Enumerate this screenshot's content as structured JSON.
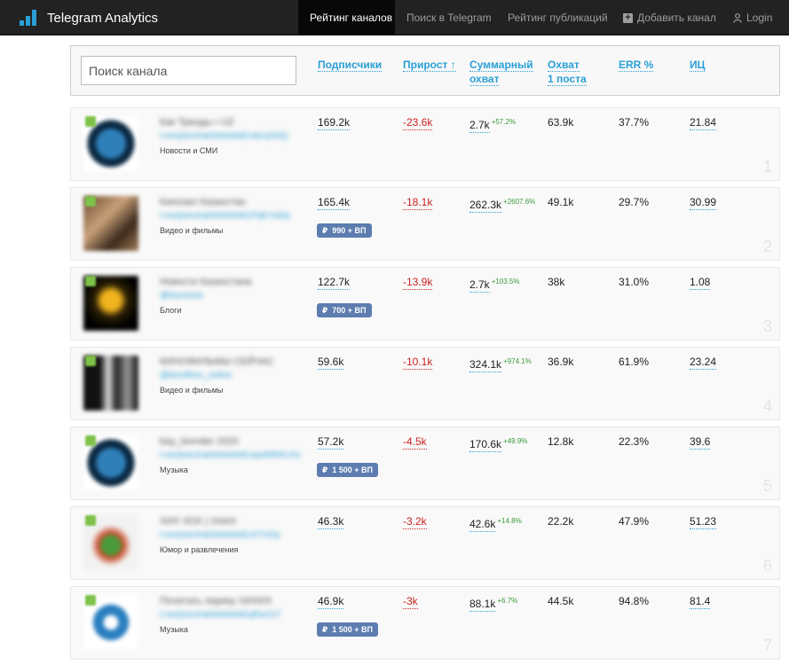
{
  "brand": {
    "title": "Telegram Analytics"
  },
  "nav": {
    "items": [
      {
        "label": "Рейтинг каналов",
        "active": true
      },
      {
        "label": "Поиск в Telegram",
        "active": false
      },
      {
        "label": "Рейтинг публикаций",
        "active": false
      },
      {
        "label": "Добавить канал",
        "active": false,
        "icon": "plus-square-icon"
      },
      {
        "label": "Login",
        "active": false,
        "icon": "user-icon"
      }
    ]
  },
  "search": {
    "placeholder": "Поиск канала",
    "value": ""
  },
  "columns": {
    "subscribers": "Подписчики",
    "growth": "Прирост ↑",
    "total_reach_1": "Суммарный",
    "total_reach_2": "охват",
    "post_reach_1": "Охват",
    "post_reach_2": "1 поста",
    "err": "ERR %",
    "ic": "ИЦ"
  },
  "rows": [
    {
      "rank": "1",
      "name": "Как Тренды • UZ",
      "link": "t.me/joinchat/AAAAAEvdsUjXdQ",
      "category": "Новости и СМИ",
      "subscribers": "169.2k",
      "growth": "-23.6k",
      "reach": "2.7k",
      "reach_delta": "+57.2%",
      "post_reach": "63.9k",
      "err": "37.7%",
      "ic": "21.84",
      "price": ""
    },
    {
      "rank": "2",
      "name": "Кинозал Казахстан",
      "link": "t.me/joinchat/AAAAAErPqkYwDq",
      "category": "Видео и фильмы",
      "subscribers": "165.4k",
      "growth": "-18.1k",
      "reach": "262.3k",
      "reach_delta": "+2607.6%",
      "post_reach": "49.1k",
      "err": "29.7%",
      "ic": "30.99",
      "price": "990 + ВП"
    },
    {
      "rank": "3",
      "name": "Новости Казахстана",
      "link": "@kaznews",
      "category": "Блоги",
      "subscribers": "122.7k",
      "growth": "-13.9k",
      "reach": "2.7k",
      "reach_delta": "+103.5%",
      "post_reach": "38k",
      "err": "31.0%",
      "ic": "1.08",
      "price": "700 + ВП"
    },
    {
      "rank": "4",
      "name": "КИНОФИЛЬМЫ СЕЙЧАС",
      "link": "@kinofilms_online",
      "category": "Видео и фильмы",
      "subscribers": "59.6k",
      "growth": "-10.1k",
      "reach": "324.1k",
      "reach_delta": "+974.1%",
      "post_reach": "36.9k",
      "err": "61.9%",
      "ic": "23.24",
      "price": ""
    },
    {
      "rank": "5",
      "name": "bay_bomder 2020",
      "link": "t.me/joinchat/AAAAAExqsdWhKvXz",
      "category": "Музыка",
      "subscribers": "57.2k",
      "growth": "-4.5k",
      "reach": "170.6k",
      "reach_delta": "+49.9%",
      "post_reach": "12.8k",
      "err": "22.3%",
      "ic": "39.6",
      "price": "1 500 + ВП"
    },
    {
      "rank": "6",
      "name": "ХИХ ХОХ | ХААХ",
      "link": "t.me/joinchat/AAAAAEsXTxDq",
      "category": "Юмор и развлечения",
      "subscribers": "46.3k",
      "growth": "-3.2k",
      "reach": "42.6k",
      "reach_delta": "+14.8%",
      "post_reach": "22.2k",
      "err": "47.9%",
      "ic": "51.23",
      "price": ""
    },
    {
      "rank": "7",
      "name": "Почитать лирику ХИХИХ",
      "link": "t.me/joinchat/AAAAAEqRwZxT",
      "category": "Музыка",
      "subscribers": "46.9k",
      "growth": "-3k",
      "reach": "88.1k",
      "reach_delta": "+6.7%",
      "post_reach": "44.5k",
      "err": "94.8%",
      "ic": "81.4",
      "price": "1 500 + ВП"
    }
  ],
  "currency_symbol": "₽",
  "colors": {
    "accent": "#2a9fd6",
    "navbar": "#222222",
    "negative": "#cc2222",
    "positive_delta": "#3a9a3a",
    "price_button": "#5d7cb0"
  }
}
